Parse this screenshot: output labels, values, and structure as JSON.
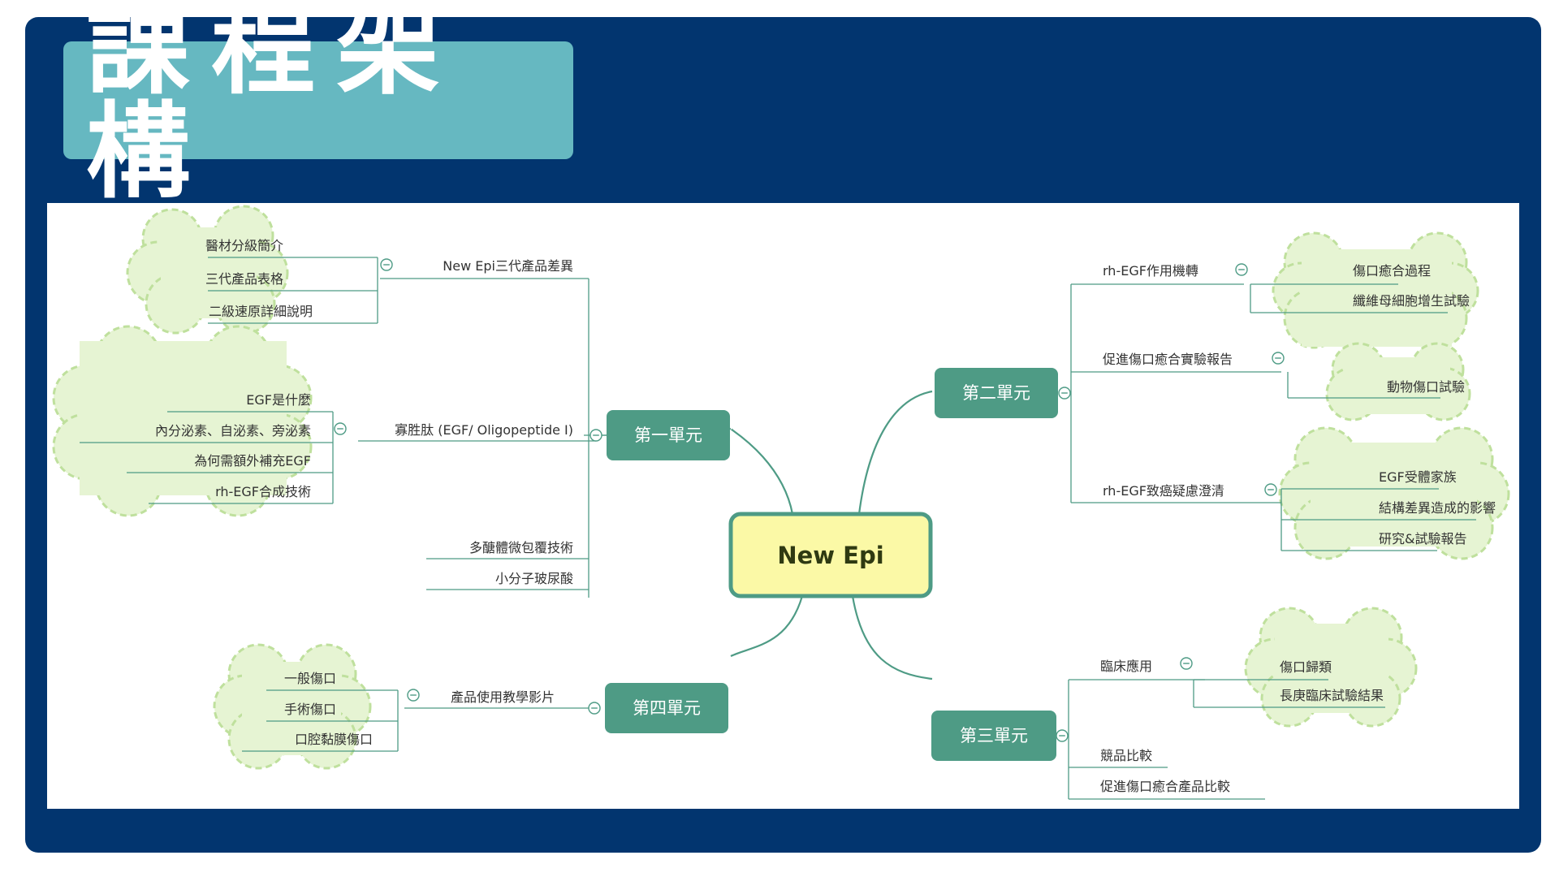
{
  "title": "課程架構",
  "colors": {
    "frame": "#02356f",
    "title_box": "#66b8c1",
    "unit_box": "#4e9b85",
    "root_fill": "#fbf9a6",
    "branch_line": "#4e9b85",
    "cloud_fill": "#e6f4d3",
    "cloud_border": "#bfe09d"
  },
  "mindmap": {
    "root": "New Epi",
    "units": {
      "u1": "第一單元",
      "u2": "第二單元",
      "u3": "第三單元",
      "u4": "第四單元"
    },
    "u1_topics": {
      "t1": "New Epi三代產品差異",
      "t2": "寡胜肽 (EGF/ Oligopeptide I)",
      "t3": "多醣體微包覆技術",
      "t4": "小分子玻尿酸"
    },
    "u1_t1_items": [
      "醫材分級簡介",
      "三代產品表格",
      "二級速原詳細說明"
    ],
    "u1_t2_items": [
      "EGF是什麼",
      "內分泌素、自泌素、旁泌素",
      "為何需額外補充EGF",
      "rh-EGF合成技術"
    ],
    "u2_topics": {
      "t1": "rh-EGF作用機轉",
      "t2": "促進傷口癒合實驗報告",
      "t3": "rh-EGF致癌疑慮澄清"
    },
    "u2_t1_items": [
      "傷口癒合過程",
      "纖維母細胞增生試驗"
    ],
    "u2_t2_items": [
      "動物傷口試驗"
    ],
    "u2_t3_items": [
      "EGF受體家族",
      "結構差異造成的影響",
      "研究&試驗報告"
    ],
    "u3_topics": {
      "t1": "臨床應用",
      "t2": "競品比較",
      "t3": "促進傷口癒合產品比較"
    },
    "u3_t1_items": [
      "傷口歸類",
      "長庚臨床試驗結果"
    ],
    "u4_topics": {
      "t1": "產品使用教學影片"
    },
    "u4_t1_items": [
      "一般傷口",
      "手術傷口",
      "口腔黏膜傷口"
    ],
    "collapse_glyph": "−"
  }
}
